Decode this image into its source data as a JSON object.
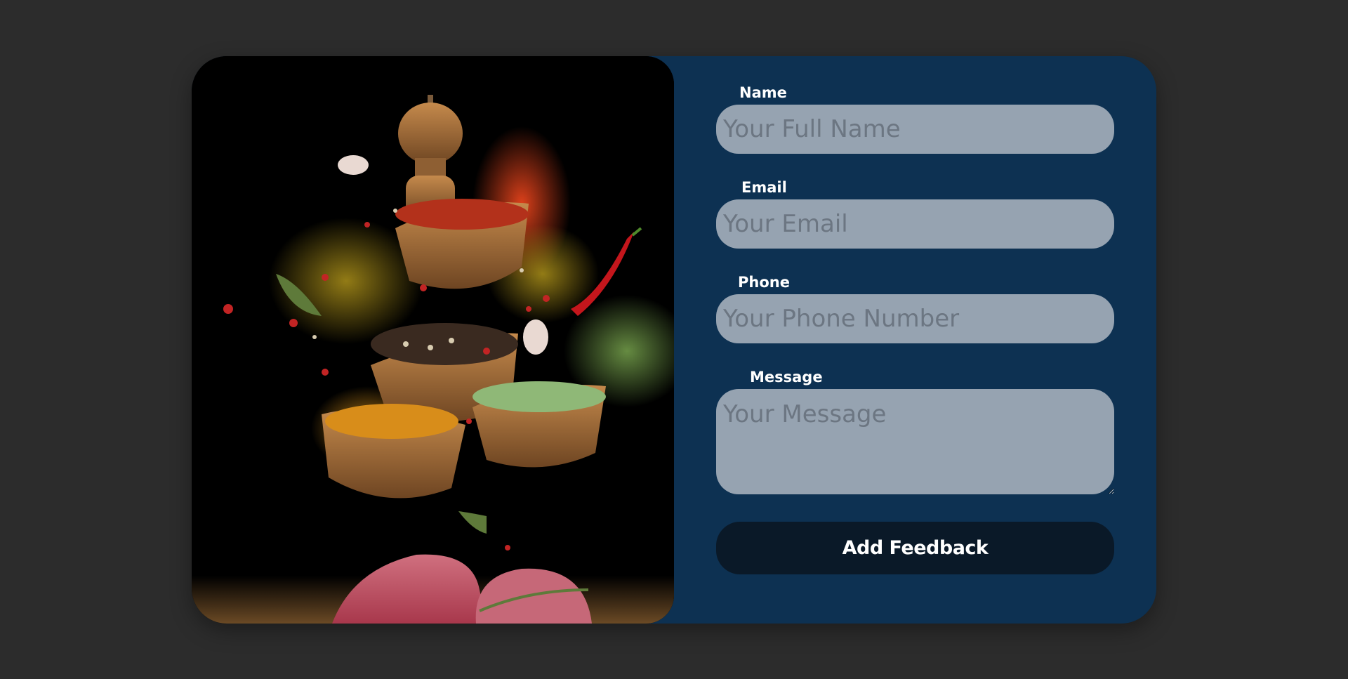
{
  "form": {
    "name_label": "Name",
    "name_placeholder": "Your Full Name",
    "email_label": "Email",
    "email_placeholder": "Your Email",
    "phone_label": "Phone",
    "phone_placeholder": "Your Phone Number",
    "message_label": "Message",
    "message_placeholder": "Your Message",
    "submit_label": "Add Feedback"
  },
  "colors": {
    "page_background": "#2c2c2c",
    "card_background": "#0d3152",
    "field_background": "#96a3b1",
    "button_background": "#0a1928"
  }
}
